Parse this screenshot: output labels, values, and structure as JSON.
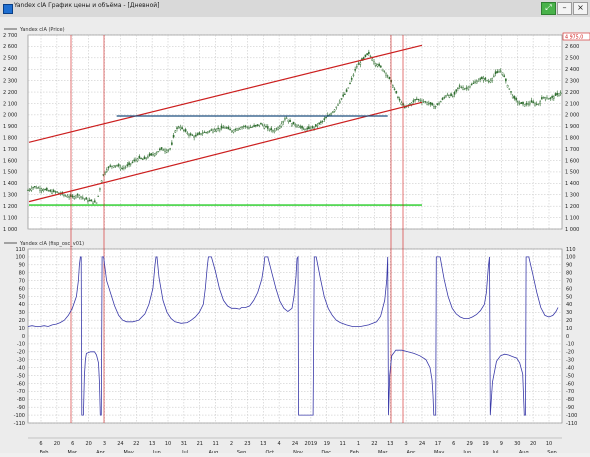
{
  "window": {
    "title": "Yandex clA График цены и объёма - [Дневной]",
    "buttons": {
      "pin": "⤢",
      "minimize": "–",
      "close": "×"
    }
  },
  "top_pane": {
    "legend": "Yandex clA (Price)",
    "price_readout": "4 975,0",
    "y_ticks": [
      "2 700",
      "2 600",
      "2 500",
      "2 400",
      "2 300",
      "2 200",
      "2 100",
      "2 000",
      "1 900",
      "1 800",
      "1 700",
      "1 600",
      "1 500",
      "1 400",
      "1 300",
      "1 200",
      "1 100",
      "1 000"
    ]
  },
  "bottom_pane": {
    "legend": "Yandex clA (fisp_osc_v01)",
    "y_ticks": [
      "110",
      "100",
      "90",
      "80",
      "70",
      "60",
      "50",
      "40",
      "30",
      "20",
      "10",
      "0",
      "-10",
      "-20",
      "-30",
      "-40",
      "-50",
      "-60",
      "-70",
      "-80",
      "-90",
      "-100",
      "-110"
    ]
  },
  "x_axis": {
    "day_ticks": [
      "6",
      "20",
      "6",
      "20",
      "3",
      "24",
      "22",
      "13",
      "10",
      "31",
      "21",
      "11",
      "2",
      "23",
      "13",
      "4",
      "24",
      "2019",
      "19",
      "11",
      "1",
      "22",
      "13",
      "3",
      "24",
      "17",
      "6",
      "29",
      "19",
      "9",
      "30",
      "20",
      "10"
    ],
    "month_ticks": [
      "Feb",
      "Mar",
      "Apr",
      "May",
      "Jun",
      "Jul",
      "Aug",
      "Sep",
      "Oct",
      "Nov",
      "Dec",
      "Feb",
      "Mar",
      "Apr",
      "May",
      "Jun",
      "Jul",
      "Aug",
      "Sep"
    ]
  },
  "colors": {
    "candle": "#2f6d2f",
    "channel": "#cc1f1f",
    "support": "#22cc22",
    "resistance": "#1f4f7f",
    "oscillator": "#3a3aa8",
    "vline": "#d01a1a",
    "grid": "#bfbfbf"
  },
  "chart_data": [
    {
      "type": "candlestick",
      "series_name": "Yandex clA (Price)",
      "ylim": [
        1000,
        2700
      ],
      "close_points": [
        [
          0,
          1340
        ],
        [
          6,
          1370
        ],
        [
          14,
          1350
        ],
        [
          22,
          1330
        ],
        [
          30,
          1320
        ],
        [
          38,
          1290
        ],
        [
          45,
          1280
        ],
        [
          50,
          1300
        ],
        [
          55,
          1270
        ],
        [
          60,
          1250
        ],
        [
          64,
          1240
        ],
        [
          68,
          1230
        ],
        [
          70,
          1300
        ],
        [
          74,
          1460
        ],
        [
          78,
          1520
        ],
        [
          82,
          1550
        ],
        [
          88,
          1560
        ],
        [
          94,
          1530
        ],
        [
          100,
          1560
        ],
        [
          106,
          1600
        ],
        [
          110,
          1620
        ],
        [
          115,
          1610
        ],
        [
          120,
          1640
        ],
        [
          126,
          1660
        ],
        [
          132,
          1700
        ],
        [
          138,
          1690
        ],
        [
          142,
          1710
        ],
        [
          146,
          1860
        ],
        [
          150,
          1900
        ],
        [
          154,
          1870
        ],
        [
          160,
          1830
        ],
        [
          166,
          1810
        ],
        [
          172,
          1840
        ],
        [
          178,
          1850
        ],
        [
          184,
          1870
        ],
        [
          190,
          1880
        ],
        [
          196,
          1890
        ],
        [
          202,
          1860
        ],
        [
          208,
          1880
        ],
        [
          214,
          1900
        ],
        [
          220,
          1890
        ],
        [
          226,
          1900
        ],
        [
          232,
          1920
        ],
        [
          238,
          1880
        ],
        [
          244,
          1860
        ],
        [
          250,
          1900
        ],
        [
          256,
          1980
        ],
        [
          262,
          1920
        ],
        [
          268,
          1910
        ],
        [
          274,
          1870
        ],
        [
          280,
          1880
        ],
        [
          286,
          1900
        ],
        [
          292,
          1940
        ],
        [
          298,
          1990
        ],
        [
          304,
          2040
        ],
        [
          310,
          2130
        ],
        [
          316,
          2200
        ],
        [
          320,
          2280
        ],
        [
          326,
          2420
        ],
        [
          332,
          2480
        ],
        [
          338,
          2540
        ],
        [
          344,
          2460
        ],
        [
          350,
          2420
        ],
        [
          356,
          2360
        ],
        [
          362,
          2260
        ],
        [
          368,
          2140
        ],
        [
          374,
          2060
        ],
        [
          380,
          2100
        ],
        [
          386,
          2140
        ],
        [
          392,
          2120
        ],
        [
          398,
          2100
        ],
        [
          404,
          2070
        ],
        [
          410,
          2120
        ],
        [
          416,
          2180
        ],
        [
          422,
          2160
        ],
        [
          428,
          2250
        ],
        [
          434,
          2230
        ],
        [
          440,
          2260
        ],
        [
          446,
          2300
        ],
        [
          452,
          2320
        ],
        [
          458,
          2290
        ],
        [
          464,
          2360
        ],
        [
          470,
          2390
        ],
        [
          476,
          2260
        ],
        [
          482,
          2150
        ],
        [
          488,
          2100
        ],
        [
          494,
          2090
        ],
        [
          500,
          2110
        ],
        [
          506,
          2090
        ],
        [
          512,
          2160
        ],
        [
          518,
          2140
        ],
        [
          524,
          2170
        ],
        [
          530,
          2200
        ]
      ],
      "channel_upper": [
        [
          1,
          1760
        ],
        [
          391,
          2610
        ]
      ],
      "channel_lower": [
        [
          1,
          1240
        ],
        [
          391,
          2110
        ]
      ],
      "resistance": [
        [
          88,
          1990
        ],
        [
          357,
          1990
        ]
      ],
      "support": [
        [
          1,
          1210
        ],
        [
          391,
          1210
        ]
      ]
    },
    {
      "type": "line",
      "series_name": "Yandex clA (fisp_osc_v01)",
      "ylim": [
        -110,
        110
      ],
      "values": [
        [
          0,
          12
        ],
        [
          4,
          13
        ],
        [
          8,
          12
        ],
        [
          12,
          12
        ],
        [
          16,
          13
        ],
        [
          20,
          12
        ],
        [
          24,
          14
        ],
        [
          28,
          15
        ],
        [
          32,
          17
        ],
        [
          36,
          20
        ],
        [
          40,
          26
        ],
        [
          44,
          35
        ],
        [
          48,
          50
        ],
        [
          50,
          70
        ],
        [
          51,
          90
        ],
        [
          52,
          100
        ],
        [
          52.8,
          100
        ],
        [
          53.4,
          -100
        ],
        [
          55,
          -100
        ],
        [
          56,
          -50
        ],
        [
          57,
          -30
        ],
        [
          58,
          -22
        ],
        [
          62,
          -20
        ],
        [
          66,
          -20
        ],
        [
          68,
          -24
        ],
        [
          70,
          -34
        ],
        [
          71,
          -60
        ],
        [
          71.8,
          -100
        ],
        [
          72.8,
          -100
        ],
        [
          73.5,
          100
        ],
        [
          75,
          100
        ],
        [
          78,
          70
        ],
        [
          82,
          54
        ],
        [
          86,
          38
        ],
        [
          90,
          26
        ],
        [
          94,
          20
        ],
        [
          98,
          18
        ],
        [
          104,
          18
        ],
        [
          110,
          20
        ],
        [
          116,
          28
        ],
        [
          120,
          40
        ],
        [
          124,
          60
        ],
        [
          126,
          90
        ],
        [
          127,
          100
        ],
        [
          128,
          100
        ],
        [
          130,
          74
        ],
        [
          134,
          45
        ],
        [
          138,
          30
        ],
        [
          142,
          22
        ],
        [
          146,
          18
        ],
        [
          152,
          16
        ],
        [
          158,
          17
        ],
        [
          162,
          20
        ],
        [
          166,
          24
        ],
        [
          170,
          30
        ],
        [
          174,
          40
        ],
        [
          176,
          60
        ],
        [
          178,
          88
        ],
        [
          179,
          100
        ],
        [
          182,
          100
        ],
        [
          186,
          82
        ],
        [
          190,
          60
        ],
        [
          194,
          45
        ],
        [
          198,
          38
        ],
        [
          202,
          35
        ],
        [
          206,
          35
        ],
        [
          210,
          34
        ],
        [
          212,
          36
        ],
        [
          216,
          36
        ],
        [
          220,
          38
        ],
        [
          224,
          45
        ],
        [
          228,
          55
        ],
        [
          232,
          72
        ],
        [
          234,
          88
        ],
        [
          235,
          100
        ],
        [
          238,
          100
        ],
        [
          242,
          80
        ],
        [
          246,
          60
        ],
        [
          250,
          44
        ],
        [
          254,
          35
        ],
        [
          258,
          31
        ],
        [
          262,
          35
        ],
        [
          264,
          50
        ],
        [
          266,
          75
        ],
        [
          267,
          98
        ],
        [
          268,
          100
        ],
        [
          268.6,
          -100
        ],
        [
          272,
          -100
        ],
        [
          278,
          -100
        ],
        [
          283,
          -100
        ],
        [
          284.2,
          100
        ],
        [
          286,
          100
        ],
        [
          290,
          74
        ],
        [
          294,
          50
        ],
        [
          298,
          35
        ],
        [
          302,
          26
        ],
        [
          306,
          20
        ],
        [
          310,
          17
        ],
        [
          316,
          14
        ],
        [
          322,
          12
        ],
        [
          330,
          12
        ],
        [
          338,
          14
        ],
        [
          346,
          18
        ],
        [
          350,
          25
        ],
        [
          354,
          45
        ],
        [
          356,
          70
        ],
        [
          357,
          100
        ],
        [
          357.8,
          -100
        ],
        [
          359,
          -50
        ],
        [
          361,
          -25
        ],
        [
          365,
          -18
        ],
        [
          371,
          -18
        ],
        [
          377,
          -20
        ],
        [
          383,
          -22
        ],
        [
          389,
          -25
        ],
        [
          395,
          -30
        ],
        [
          399,
          -40
        ],
        [
          401,
          -55
        ],
        [
          402,
          -75
        ],
        [
          402.8,
          -100
        ],
        [
          404.6,
          -100
        ],
        [
          405.2,
          100
        ],
        [
          409,
          100
        ],
        [
          413,
          72
        ],
        [
          417,
          50
        ],
        [
          421,
          35
        ],
        [
          425,
          28
        ],
        [
          429,
          24
        ],
        [
          433,
          22
        ],
        [
          437,
          22
        ],
        [
          441,
          24
        ],
        [
          445,
          27
        ],
        [
          449,
          32
        ],
        [
          453,
          40
        ],
        [
          455,
          55
        ],
        [
          456,
          72
        ],
        [
          457,
          88
        ],
        [
          458,
          100
        ],
        [
          458.8,
          -100
        ],
        [
          461,
          -58
        ],
        [
          465,
          -32
        ],
        [
          469,
          -25
        ],
        [
          473,
          -23
        ],
        [
          477,
          -24
        ],
        [
          481,
          -26
        ],
        [
          485,
          -28
        ],
        [
          488,
          -34
        ],
        [
          491,
          -48
        ],
        [
          492.6,
          -100
        ],
        [
          493.8,
          -100
        ],
        [
          494.4,
          100
        ],
        [
          497,
          100
        ],
        [
          501,
          78
        ],
        [
          505,
          55
        ],
        [
          509,
          36
        ],
        [
          513,
          26
        ],
        [
          517,
          24
        ],
        [
          521,
          26
        ],
        [
          524,
          31
        ],
        [
          526,
          36
        ]
      ]
    }
  ]
}
